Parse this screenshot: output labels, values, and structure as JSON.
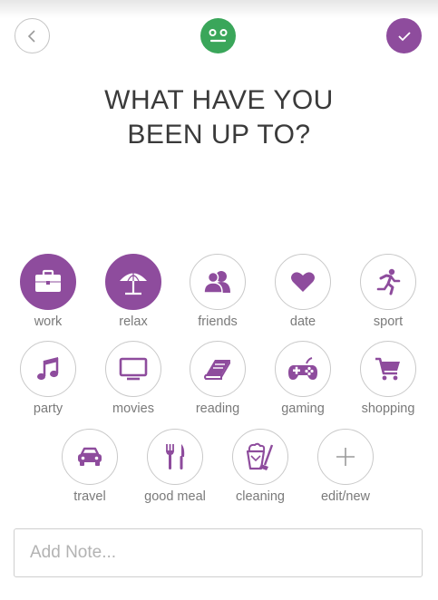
{
  "header": {
    "back_icon": "chevron-left-icon",
    "mood_icon": "smiley-face-icon",
    "confirm_icon": "checkmark-icon",
    "mood_color": "#3aa65a",
    "accent_color": "#8e4c9d"
  },
  "title": {
    "line1": "WHAT HAVE YOU",
    "line2": "BEEN UP TO?"
  },
  "activities": [
    {
      "label": "work",
      "icon": "briefcase-icon",
      "selected": true
    },
    {
      "label": "relax",
      "icon": "beach-umbrella-icon",
      "selected": true
    },
    {
      "label": "friends",
      "icon": "people-icon",
      "selected": false
    },
    {
      "label": "date",
      "icon": "heart-icon",
      "selected": false
    },
    {
      "label": "sport",
      "icon": "running-icon",
      "selected": false
    },
    {
      "label": "party",
      "icon": "music-note-icon",
      "selected": false
    },
    {
      "label": "movies",
      "icon": "tv-icon",
      "selected": false
    },
    {
      "label": "reading",
      "icon": "book-icon",
      "selected": false
    },
    {
      "label": "gaming",
      "icon": "gamepad-icon",
      "selected": false
    },
    {
      "label": "shopping",
      "icon": "cart-icon",
      "selected": false
    },
    {
      "label": "travel",
      "icon": "car-icon",
      "selected": false
    },
    {
      "label": "good meal",
      "icon": "fork-knife-icon",
      "selected": false
    },
    {
      "label": "cleaning",
      "icon": "cleaning-bucket-icon",
      "selected": false
    },
    {
      "label": "edit/new",
      "icon": "plus-icon",
      "selected": false
    }
  ],
  "note": {
    "placeholder": "Add Note..."
  }
}
